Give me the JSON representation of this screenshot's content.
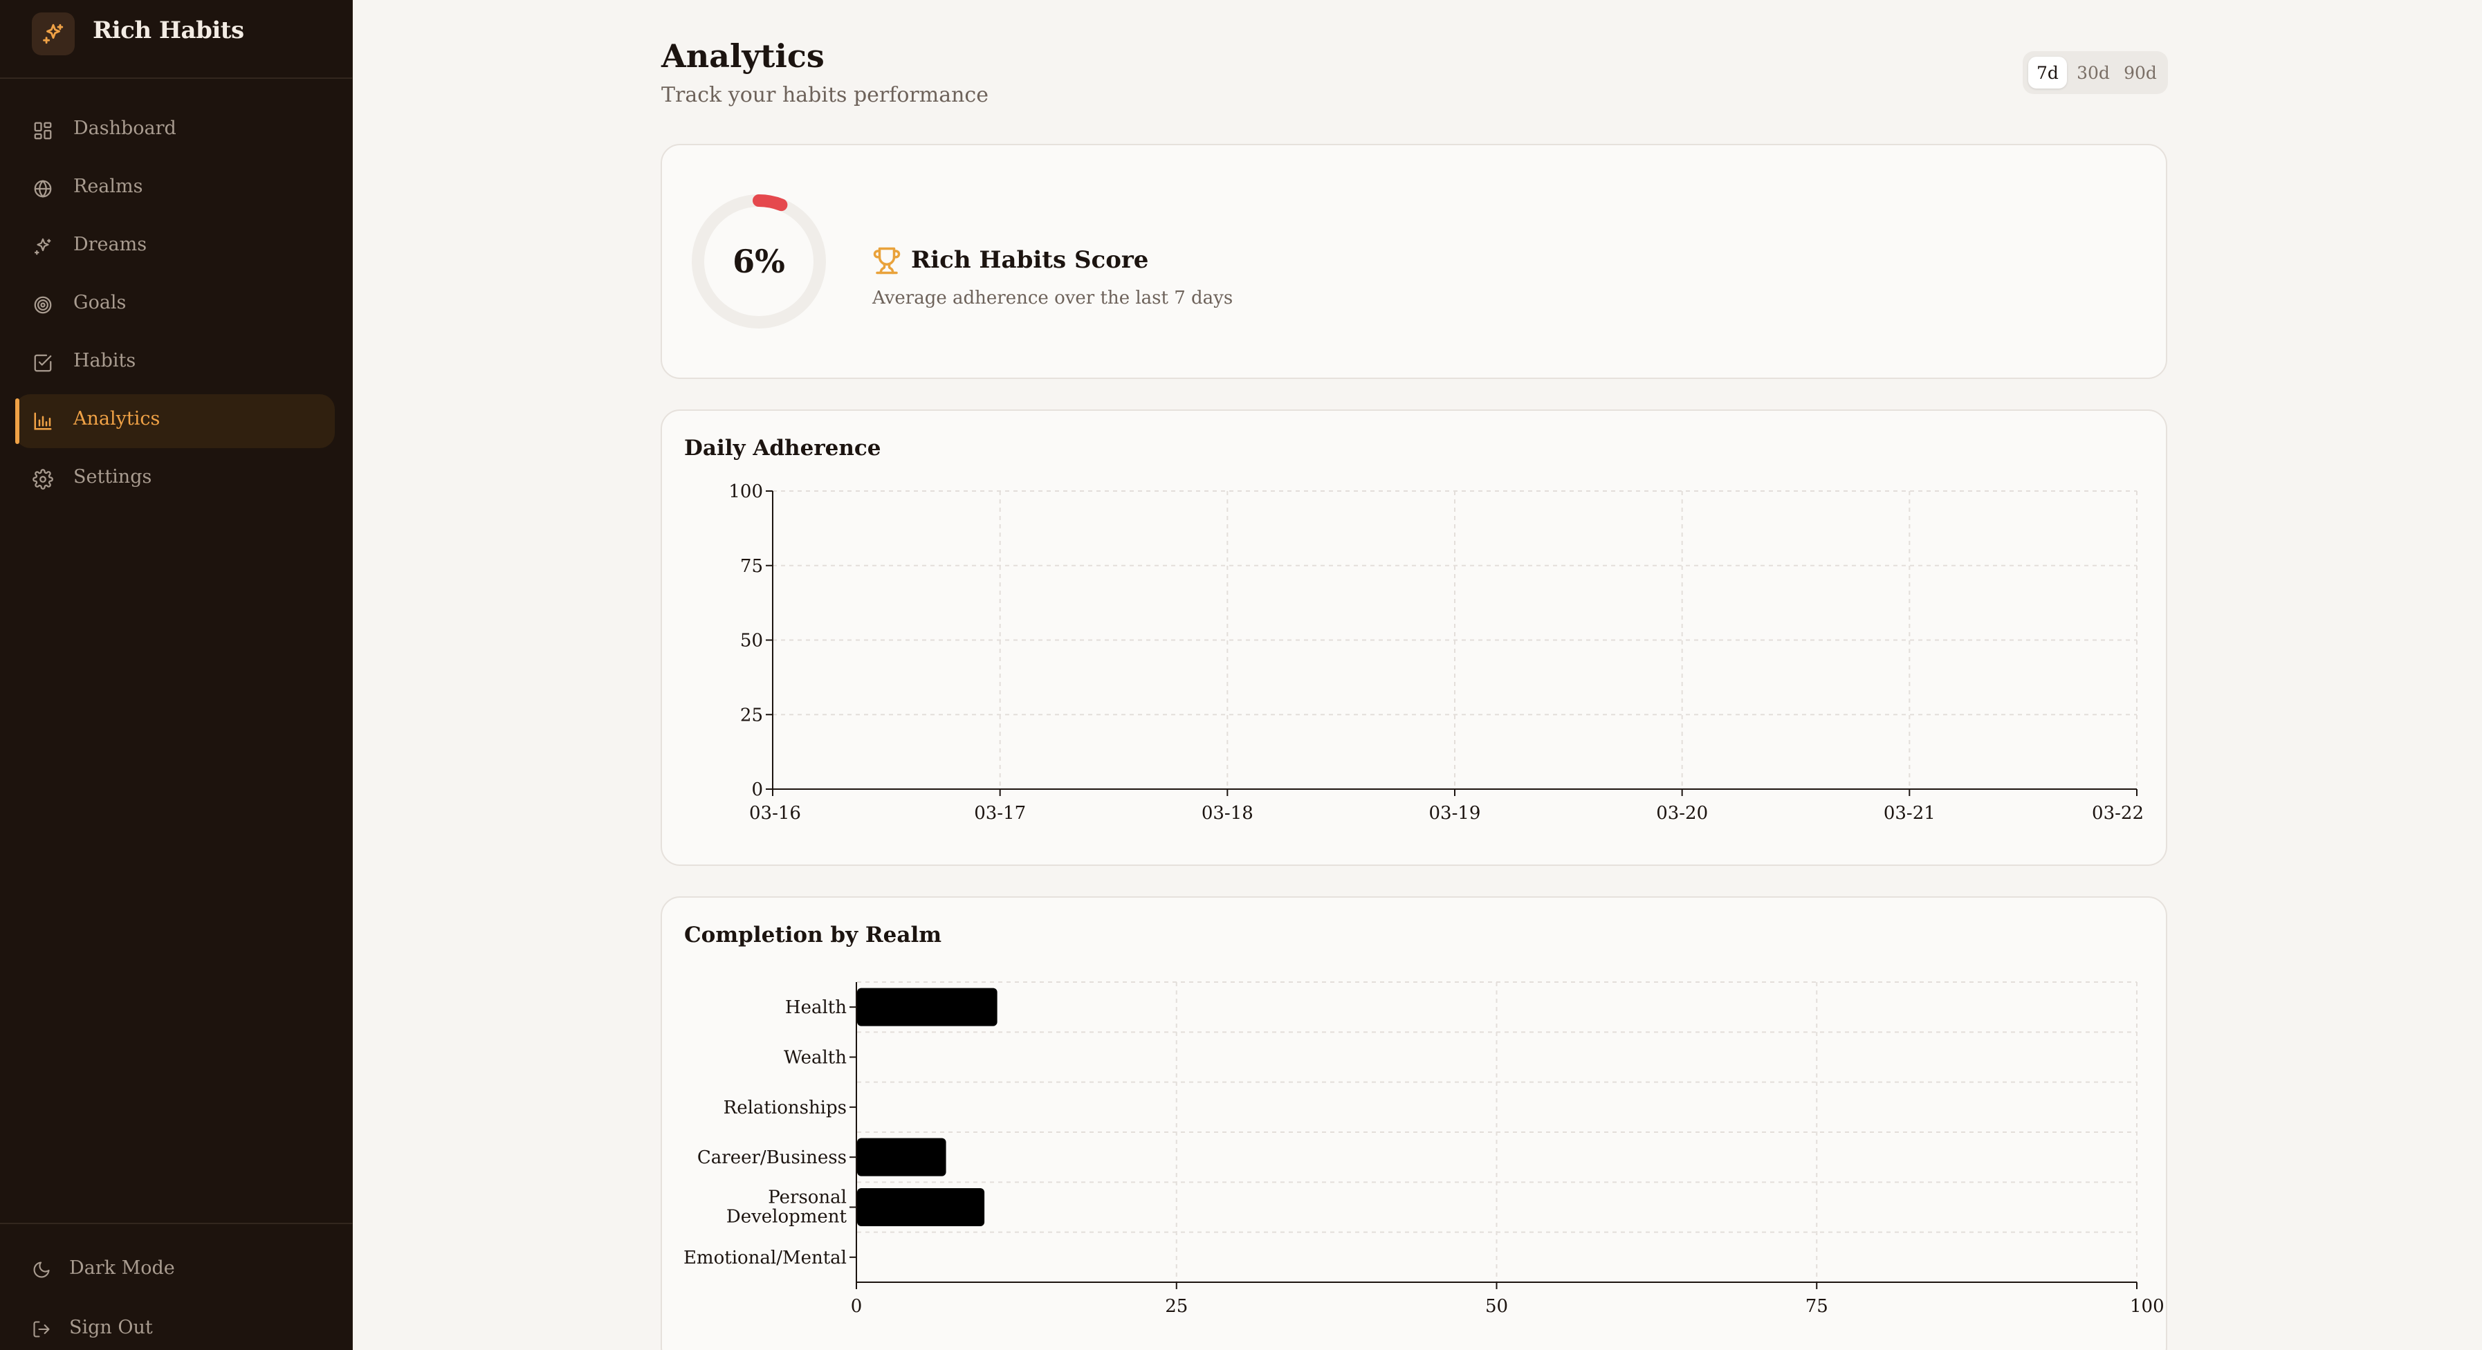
{
  "app": {
    "name": "Rich Habits"
  },
  "sidebar": {
    "items": [
      {
        "label": "Dashboard",
        "icon": "grid-icon",
        "active": false
      },
      {
        "label": "Realms",
        "icon": "globe-icon",
        "active": false
      },
      {
        "label": "Dreams",
        "icon": "sparkles-icon",
        "active": false
      },
      {
        "label": "Goals",
        "icon": "target-icon",
        "active": false
      },
      {
        "label": "Habits",
        "icon": "checkbox-icon",
        "active": false
      },
      {
        "label": "Analytics",
        "icon": "bar-chart-icon",
        "active": true
      },
      {
        "label": "Settings",
        "icon": "gear-icon",
        "active": false
      }
    ],
    "bottom": {
      "dark_mode": "Dark Mode",
      "sign_out": "Sign Out"
    }
  },
  "header": {
    "title": "Analytics",
    "subtitle": "Track your habits performance",
    "ranges": [
      "7d",
      "30d",
      "90d"
    ],
    "selected_range": "7d"
  },
  "score": {
    "value_label": "6%",
    "value": 6,
    "title": "Rich Habits Score",
    "description": "Average adherence over the last 7 days",
    "ring_color": "#e5484d",
    "trophy_color": "#e9a23b"
  },
  "chart_data": [
    {
      "type": "line",
      "title": "Daily Adherence",
      "x": [
        "03-16",
        "03-17",
        "03-18",
        "03-19",
        "03-20",
        "03-21",
        "03-22"
      ],
      "series": [],
      "ylim": [
        0,
        100
      ],
      "yticks": [
        0,
        25,
        50,
        75,
        100
      ],
      "grid": true
    },
    {
      "type": "bar",
      "orientation": "horizontal",
      "title": "Completion by Realm",
      "categories": [
        "Health",
        "Wealth",
        "Relationships",
        "Career/Business",
        "Personal Development",
        "Emotional/Mental"
      ],
      "values": [
        11,
        0,
        0,
        7,
        10,
        0
      ],
      "xlim": [
        0,
        100
      ],
      "xticks": [
        0,
        25,
        50,
        75,
        100
      ],
      "bar_color": "#000000",
      "grid": true
    }
  ]
}
